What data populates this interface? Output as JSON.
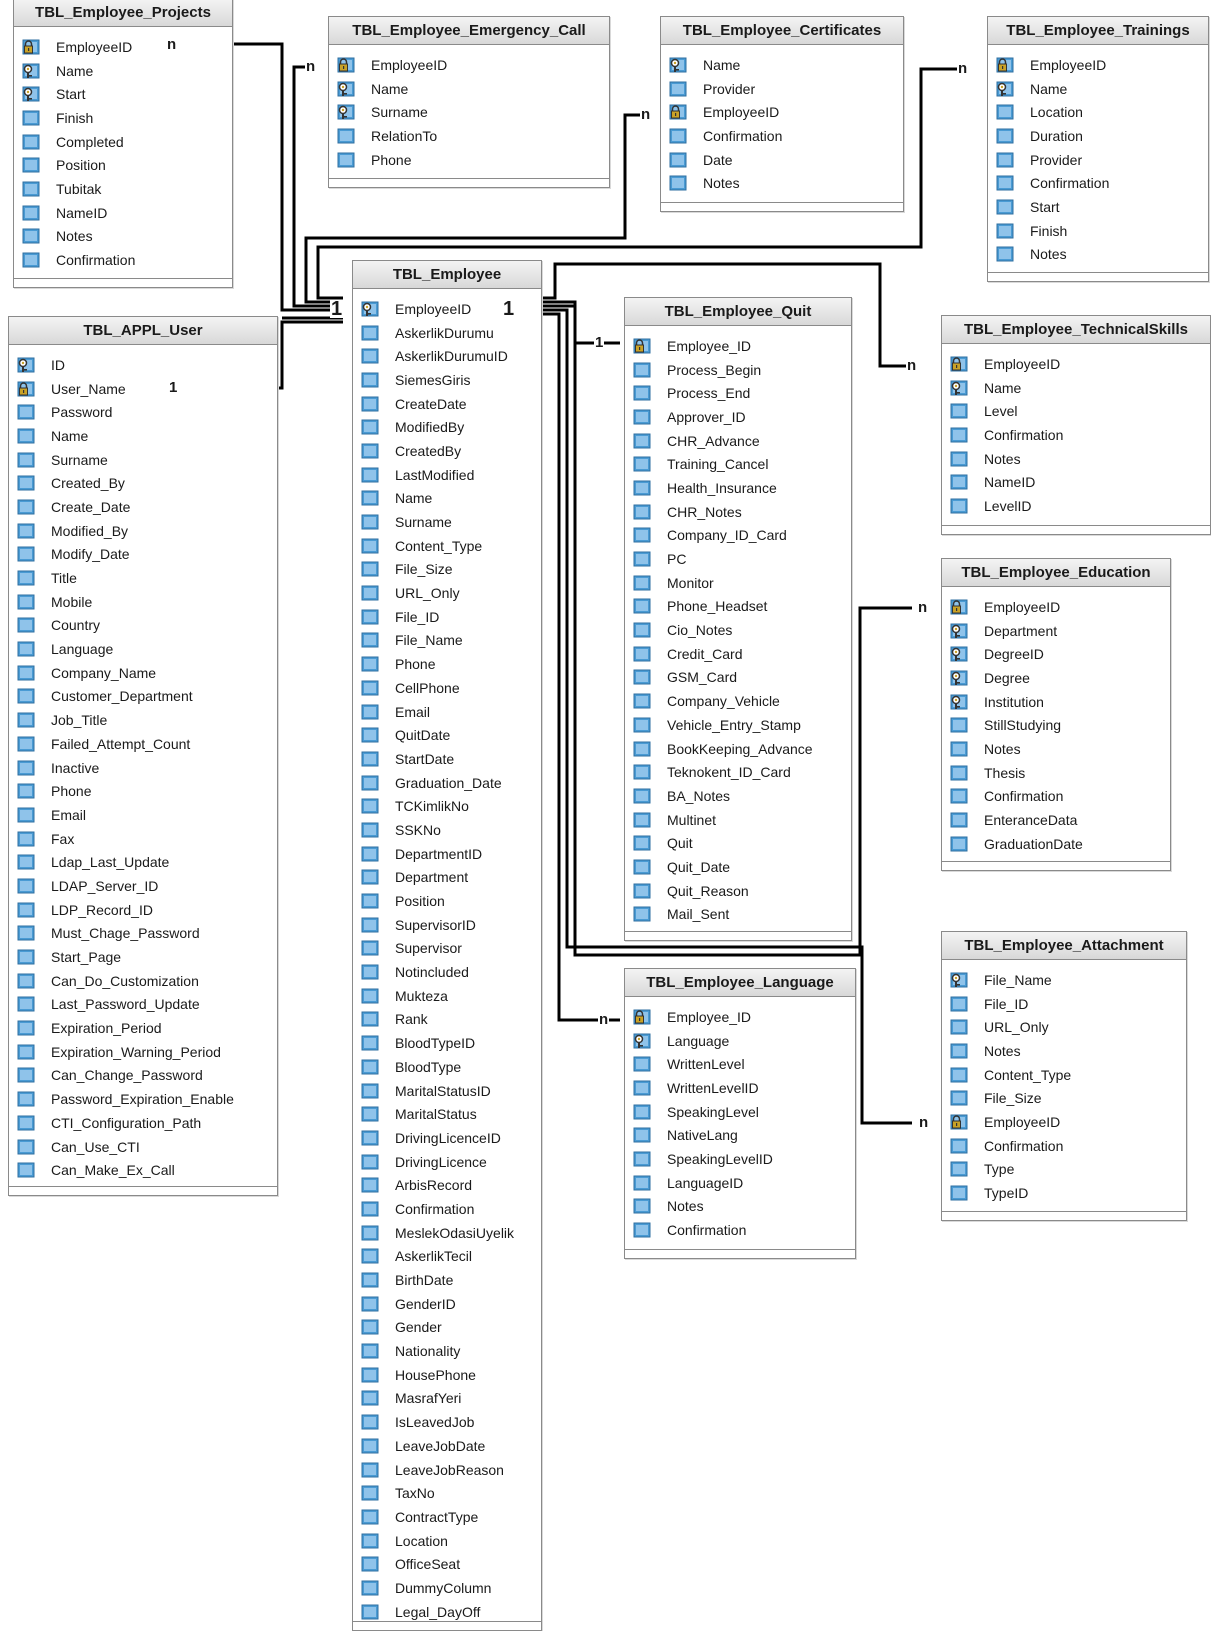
{
  "tables": [
    {
      "id": "projects",
      "name": "TBL_Employee_Projects",
      "fields": [
        {
          "name": "EmployeeID",
          "key": "lock"
        },
        {
          "name": "Name",
          "key": "key"
        },
        {
          "name": "Start",
          "key": "key"
        },
        {
          "name": "Finish",
          "key": ""
        },
        {
          "name": "Completed",
          "key": ""
        },
        {
          "name": "Position",
          "key": ""
        },
        {
          "name": "Tubitak",
          "key": ""
        },
        {
          "name": "NameID",
          "key": ""
        },
        {
          "name": "Notes",
          "key": ""
        },
        {
          "name": "Confirmation",
          "key": ""
        }
      ]
    },
    {
      "id": "emergency",
      "name": "TBL_Employee_Emergency_Call",
      "fields": [
        {
          "name": "EmployeeID",
          "key": "lock"
        },
        {
          "name": "Name",
          "key": "key"
        },
        {
          "name": "Surname",
          "key": "key"
        },
        {
          "name": "RelationTo",
          "key": ""
        },
        {
          "name": "Phone",
          "key": ""
        }
      ]
    },
    {
      "id": "certificates",
      "name": "TBL_Employee_Certificates",
      "fields": [
        {
          "name": "Name",
          "key": "key"
        },
        {
          "name": "Provider",
          "key": ""
        },
        {
          "name": "EmployeeID",
          "key": "lock"
        },
        {
          "name": "Confirmation",
          "key": ""
        },
        {
          "name": "Date",
          "key": ""
        },
        {
          "name": "Notes",
          "key": ""
        }
      ]
    },
    {
      "id": "trainings",
      "name": "TBL_Employee_Trainings",
      "fields": [
        {
          "name": "EmployeeID",
          "key": "lock"
        },
        {
          "name": "Name",
          "key": "key"
        },
        {
          "name": "Location",
          "key": ""
        },
        {
          "name": "Duration",
          "key": ""
        },
        {
          "name": "Provider",
          "key": ""
        },
        {
          "name": "Confirmation",
          "key": ""
        },
        {
          "name": "Start",
          "key": ""
        },
        {
          "name": "Finish",
          "key": ""
        },
        {
          "name": "Notes",
          "key": ""
        }
      ]
    },
    {
      "id": "appluser",
      "name": "TBL_APPL_User",
      "fields": [
        {
          "name": "ID",
          "key": "key"
        },
        {
          "name": "User_Name",
          "key": "lock"
        },
        {
          "name": "Password",
          "key": ""
        },
        {
          "name": "Name",
          "key": ""
        },
        {
          "name": "Surname",
          "key": ""
        },
        {
          "name": "Created_By",
          "key": ""
        },
        {
          "name": "Create_Date",
          "key": ""
        },
        {
          "name": "Modified_By",
          "key": ""
        },
        {
          "name": "Modify_Date",
          "key": ""
        },
        {
          "name": "Title",
          "key": ""
        },
        {
          "name": "Mobile",
          "key": ""
        },
        {
          "name": "Country",
          "key": ""
        },
        {
          "name": "Language",
          "key": ""
        },
        {
          "name": "Company_Name",
          "key": ""
        },
        {
          "name": "Customer_Department",
          "key": ""
        },
        {
          "name": "Job_Title",
          "key": ""
        },
        {
          "name": "Failed_Attempt_Count",
          "key": ""
        },
        {
          "name": "Inactive",
          "key": ""
        },
        {
          "name": "Phone",
          "key": ""
        },
        {
          "name": "Email",
          "key": ""
        },
        {
          "name": "Fax",
          "key": ""
        },
        {
          "name": "Ldap_Last_Update",
          "key": ""
        },
        {
          "name": "LDAP_Server_ID",
          "key": ""
        },
        {
          "name": "LDP_Record_ID",
          "key": ""
        },
        {
          "name": "Must_Chage_Password",
          "key": ""
        },
        {
          "name": "Start_Page",
          "key": ""
        },
        {
          "name": "Can_Do_Customization",
          "key": ""
        },
        {
          "name": "Last_Password_Update",
          "key": ""
        },
        {
          "name": "Expiration_Period",
          "key": ""
        },
        {
          "name": "Expiration_Warning_Period",
          "key": ""
        },
        {
          "name": "Can_Change_Password",
          "key": ""
        },
        {
          "name": "Password_Expiration_Enable",
          "key": ""
        },
        {
          "name": "CTI_Configuration_Path",
          "key": ""
        },
        {
          "name": "Can_Use_CTI",
          "key": ""
        },
        {
          "name": "Can_Make_Ex_Call",
          "key": ""
        }
      ]
    },
    {
      "id": "employee",
      "name": "TBL_Employee",
      "fields": [
        {
          "name": "EmployeeID",
          "key": "key"
        },
        {
          "name": "AskerlikDurumu",
          "key": ""
        },
        {
          "name": "AskerlikDurumuID",
          "key": ""
        },
        {
          "name": "SiemesGiris",
          "key": ""
        },
        {
          "name": "CreateDate",
          "key": ""
        },
        {
          "name": "ModifiedBy",
          "key": ""
        },
        {
          "name": "CreatedBy",
          "key": ""
        },
        {
          "name": "LastModified",
          "key": ""
        },
        {
          "name": "Name",
          "key": ""
        },
        {
          "name": "Surname",
          "key": ""
        },
        {
          "name": "Content_Type",
          "key": ""
        },
        {
          "name": "File_Size",
          "key": ""
        },
        {
          "name": "URL_Only",
          "key": ""
        },
        {
          "name": "File_ID",
          "key": ""
        },
        {
          "name": "File_Name",
          "key": ""
        },
        {
          "name": "Phone",
          "key": ""
        },
        {
          "name": "CellPhone",
          "key": ""
        },
        {
          "name": "Email",
          "key": ""
        },
        {
          "name": "QuitDate",
          "key": ""
        },
        {
          "name": "StartDate",
          "key": ""
        },
        {
          "name": "Graduation_Date",
          "key": ""
        },
        {
          "name": "TCKimlikNo",
          "key": ""
        },
        {
          "name": "SSKNo",
          "key": ""
        },
        {
          "name": "DepartmentID",
          "key": ""
        },
        {
          "name": "Department",
          "key": ""
        },
        {
          "name": "Position",
          "key": ""
        },
        {
          "name": "SupervisorID",
          "key": ""
        },
        {
          "name": "Supervisor",
          "key": ""
        },
        {
          "name": "Notincluded",
          "key": ""
        },
        {
          "name": "Mukteza",
          "key": ""
        },
        {
          "name": "Rank",
          "key": ""
        },
        {
          "name": "BloodTypeID",
          "key": ""
        },
        {
          "name": "BloodType",
          "key": ""
        },
        {
          "name": "MaritalStatusID",
          "key": ""
        },
        {
          "name": "MaritalStatus",
          "key": ""
        },
        {
          "name": "DrivingLicenceID",
          "key": ""
        },
        {
          "name": "DrivingLicence",
          "key": ""
        },
        {
          "name": "ArbisRecord",
          "key": ""
        },
        {
          "name": "Confirmation",
          "key": ""
        },
        {
          "name": "MeslekOdasiUyelik",
          "key": ""
        },
        {
          "name": "AskerlikTecil",
          "key": ""
        },
        {
          "name": "BirthDate",
          "key": ""
        },
        {
          "name": "GenderID",
          "key": ""
        },
        {
          "name": "Gender",
          "key": ""
        },
        {
          "name": "Nationality",
          "key": ""
        },
        {
          "name": "HousePhone",
          "key": ""
        },
        {
          "name": "MasrafYeri",
          "key": ""
        },
        {
          "name": "IsLeavedJob",
          "key": ""
        },
        {
          "name": "LeaveJobDate",
          "key": ""
        },
        {
          "name": "LeaveJobReason",
          "key": ""
        },
        {
          "name": "TaxNo",
          "key": ""
        },
        {
          "name": "ContractType",
          "key": ""
        },
        {
          "name": "Location",
          "key": ""
        },
        {
          "name": "OfficeSeat",
          "key": ""
        },
        {
          "name": "DummyColumn",
          "key": ""
        },
        {
          "name": "Legal_DayOff",
          "key": ""
        }
      ]
    },
    {
      "id": "quit",
      "name": "TBL_Employee_Quit",
      "fields": [
        {
          "name": "Employee_ID",
          "key": "lock"
        },
        {
          "name": "Process_Begin",
          "key": ""
        },
        {
          "name": "Process_End",
          "key": ""
        },
        {
          "name": "Approver_ID",
          "key": ""
        },
        {
          "name": "CHR_Advance",
          "key": ""
        },
        {
          "name": "Training_Cancel",
          "key": ""
        },
        {
          "name": "Health_Insurance",
          "key": ""
        },
        {
          "name": "CHR_Notes",
          "key": ""
        },
        {
          "name": "Company_ID_Card",
          "key": ""
        },
        {
          "name": "PC",
          "key": ""
        },
        {
          "name": "Monitor",
          "key": ""
        },
        {
          "name": "Phone_Headset",
          "key": ""
        },
        {
          "name": "Cio_Notes",
          "key": ""
        },
        {
          "name": "Credit_Card",
          "key": ""
        },
        {
          "name": "GSM_Card",
          "key": ""
        },
        {
          "name": "Company_Vehicle",
          "key": ""
        },
        {
          "name": "Vehicle_Entry_Stamp",
          "key": ""
        },
        {
          "name": "BookKeeping_Advance",
          "key": ""
        },
        {
          "name": "Teknokent_ID_Card",
          "key": ""
        },
        {
          "name": "BA_Notes",
          "key": ""
        },
        {
          "name": "Multinet",
          "key": ""
        },
        {
          "name": "Quit",
          "key": ""
        },
        {
          "name": "Quit_Date",
          "key": ""
        },
        {
          "name": "Quit_Reason",
          "key": ""
        },
        {
          "name": "Mail_Sent",
          "key": ""
        }
      ]
    },
    {
      "id": "technical",
      "name": "TBL_Employee_TechnicalSkills",
      "fields": [
        {
          "name": "EmployeeID",
          "key": "lock"
        },
        {
          "name": "Name",
          "key": "key"
        },
        {
          "name": "Level",
          "key": ""
        },
        {
          "name": "Confirmation",
          "key": ""
        },
        {
          "name": "Notes",
          "key": ""
        },
        {
          "name": "NameID",
          "key": ""
        },
        {
          "name": "LevelID",
          "key": ""
        }
      ]
    },
    {
      "id": "education",
      "name": "TBL_Employee_Education",
      "fields": [
        {
          "name": "EmployeeID",
          "key": "lock"
        },
        {
          "name": "Department",
          "key": "key"
        },
        {
          "name": "DegreeID",
          "key": "key"
        },
        {
          "name": "Degree",
          "key": "key"
        },
        {
          "name": "Institution",
          "key": "key"
        },
        {
          "name": "StillStudying",
          "key": ""
        },
        {
          "name": "Notes",
          "key": ""
        },
        {
          "name": "Thesis",
          "key": ""
        },
        {
          "name": "Confirmation",
          "key": ""
        },
        {
          "name": "EnteranceData",
          "key": ""
        },
        {
          "name": "GraduationDate",
          "key": ""
        }
      ]
    },
    {
      "id": "language",
      "name": "TBL_Employee_Language",
      "fields": [
        {
          "name": "Employee_ID",
          "key": "lock"
        },
        {
          "name": "Language",
          "key": "key"
        },
        {
          "name": "WrittenLevel",
          "key": ""
        },
        {
          "name": "WrittenLevelID",
          "key": ""
        },
        {
          "name": "SpeakingLevel",
          "key": ""
        },
        {
          "name": "NativeLang",
          "key": ""
        },
        {
          "name": "SpeakingLevelID",
          "key": ""
        },
        {
          "name": "LanguageID",
          "key": ""
        },
        {
          "name": "Notes",
          "key": ""
        },
        {
          "name": "Confirmation",
          "key": ""
        }
      ]
    },
    {
      "id": "attachment",
      "name": "TBL_Employee_Attachment",
      "fields": [
        {
          "name": "File_Name",
          "key": "key"
        },
        {
          "name": "File_ID",
          "key": ""
        },
        {
          "name": "URL_Only",
          "key": ""
        },
        {
          "name": "Notes",
          "key": ""
        },
        {
          "name": "Content_Type",
          "key": ""
        },
        {
          "name": "File_Size",
          "key": ""
        },
        {
          "name": "EmployeeID",
          "key": "lock"
        },
        {
          "name": "Confirmation",
          "key": ""
        },
        {
          "name": "Type",
          "key": ""
        },
        {
          "name": "TypeID",
          "key": ""
        }
      ]
    }
  ],
  "cardinality_labels": [
    {
      "id": "projects-n",
      "text": "n"
    },
    {
      "id": "emergency-n",
      "text": "n"
    },
    {
      "id": "certificates-n",
      "text": "n"
    },
    {
      "id": "trainings-n",
      "text": "n"
    },
    {
      "id": "appl-1",
      "text": "1"
    },
    {
      "id": "employee-1a",
      "text": "1"
    },
    {
      "id": "employee-1b",
      "text": "1"
    },
    {
      "id": "quit-1",
      "text": "1"
    },
    {
      "id": "technical-n",
      "text": "n"
    },
    {
      "id": "education-n",
      "text": "n"
    },
    {
      "id": "language-n",
      "text": "n"
    },
    {
      "id": "attachment-n",
      "text": "n"
    }
  ],
  "colors": {
    "line": "#000000",
    "header_top": "#f4f4f4",
    "header_bottom": "#d8d8d8",
    "border": "#8a8a8a",
    "column_icon": "#4a9bd4",
    "key_icon": "#c9a227"
  }
}
